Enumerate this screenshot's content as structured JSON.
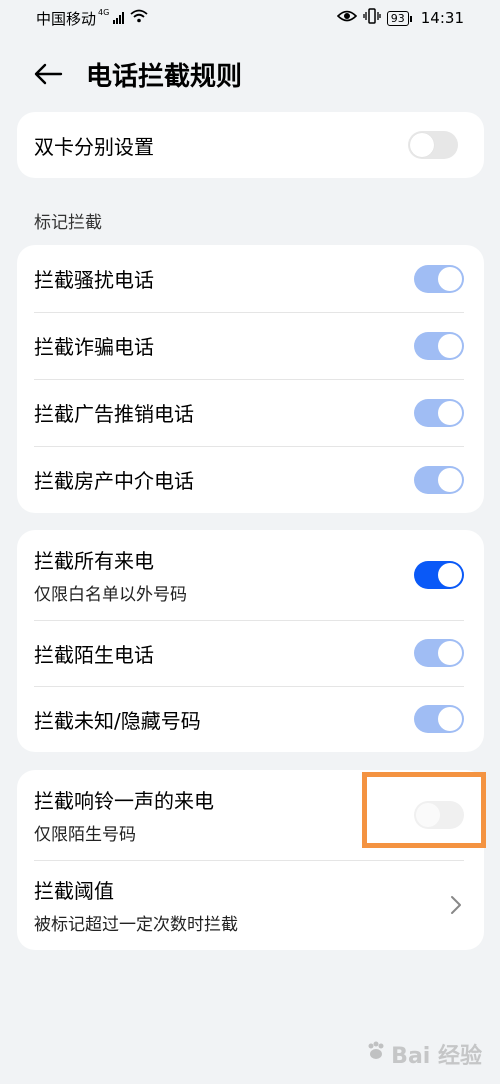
{
  "status": {
    "carrier": "中国移动",
    "network_type": "4G",
    "battery": "93",
    "time": "14:31"
  },
  "header": {
    "title": "电话拦截规则"
  },
  "dual_sim": {
    "label": "双卡分别设置",
    "enabled": false
  },
  "mark_section": {
    "label": "标记拦截",
    "items": [
      {
        "label": "拦截骚扰电话",
        "enabled": true
      },
      {
        "label": "拦截诈骗电话",
        "enabled": true
      },
      {
        "label": "拦截广告推销电话",
        "enabled": true
      },
      {
        "label": "拦截房产中介电话",
        "enabled": true
      }
    ]
  },
  "call_section": {
    "items": [
      {
        "label": "拦截所有来电",
        "sub": "仅限白名单以外号码",
        "enabled": true
      },
      {
        "label": "拦截陌生电话",
        "enabled": true
      },
      {
        "label": "拦截未知/隐藏号码",
        "enabled": true
      }
    ]
  },
  "ring_section": {
    "items": [
      {
        "label": "拦截响铃一声的来电",
        "sub": "仅限陌生号码",
        "enabled": false
      },
      {
        "label": "拦截阈值",
        "sub": "被标记超过一定次数时拦截"
      }
    ]
  },
  "watermark": "Bai 经验",
  "colors": {
    "toggle_on_strong": "#0a59f7",
    "toggle_on_light": "#a0bdf4",
    "toggle_off": "#e7e7e7",
    "highlight": "#f49341"
  }
}
